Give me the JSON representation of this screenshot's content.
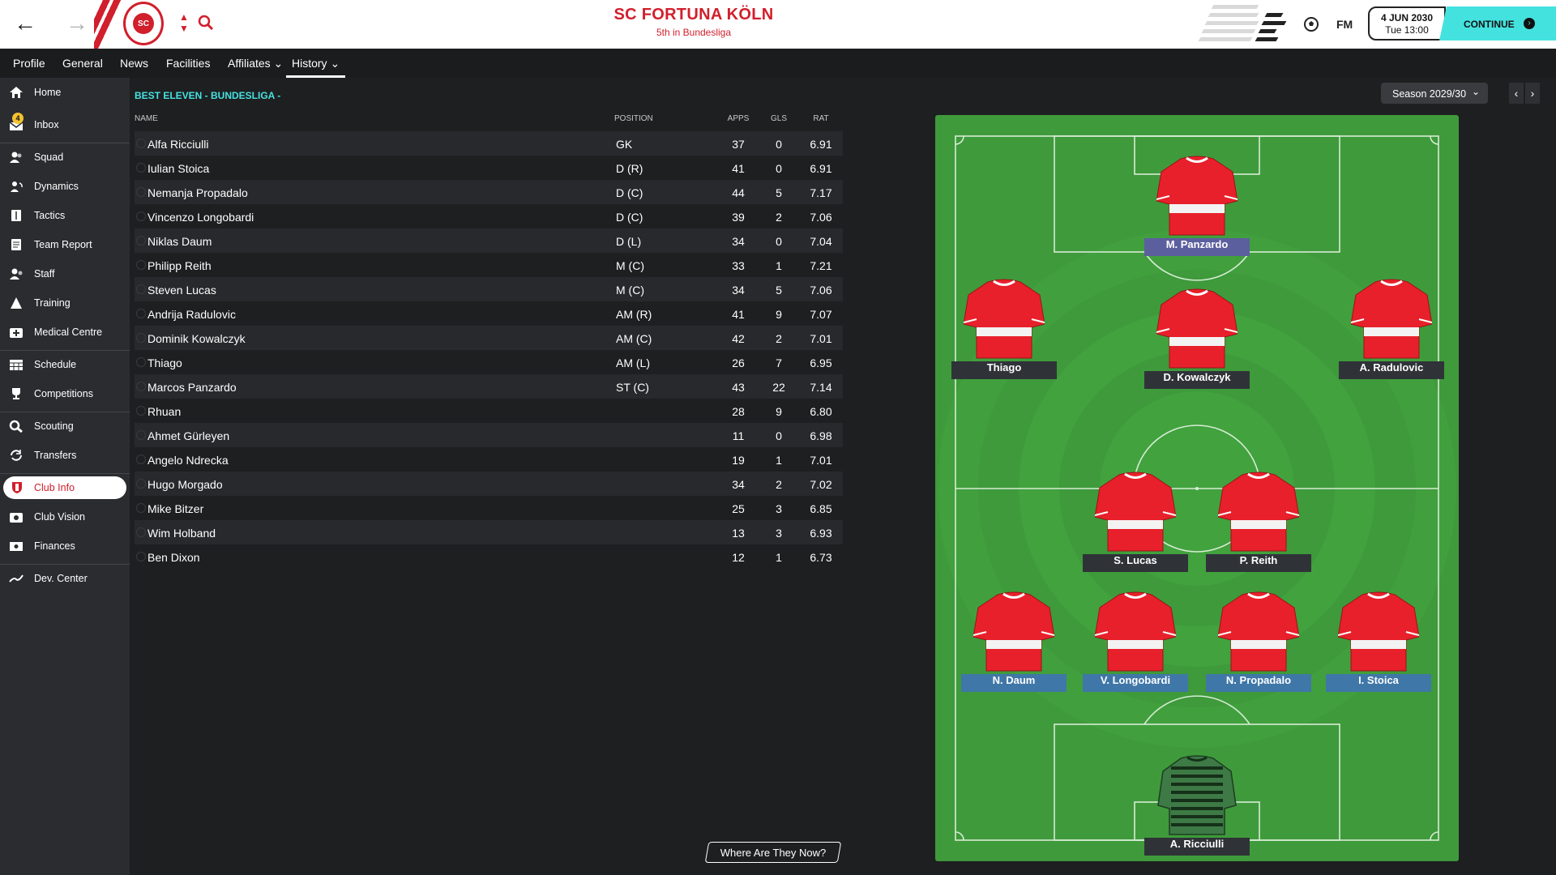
{
  "header": {
    "club_name": "SC FORTUNA KÖLN",
    "club_sub": "5th in Bundesliga",
    "crest_text": "SC FORTUNA KÖLN",
    "fm_logo": "FM",
    "date": "4 JUN 2030",
    "time": "Tue 13:00",
    "continue_label": "CONTINUE",
    "back_icon": "←",
    "forward_icon": "→",
    "continue_icon": "›"
  },
  "tabs": [
    {
      "label": "Profile"
    },
    {
      "label": "General"
    },
    {
      "label": "News"
    },
    {
      "label": "Facilities"
    },
    {
      "label": "Affiliates ⌄"
    },
    {
      "label": "History ⌄"
    }
  ],
  "sidebar": {
    "inbox_badge": "4",
    "items": [
      {
        "label": "Home",
        "icon": "home-icon"
      },
      {
        "label": "Inbox",
        "icon": "inbox-icon"
      },
      {
        "label": "Squad",
        "icon": "squad-icon"
      },
      {
        "label": "Dynamics",
        "icon": "dynamics-icon"
      },
      {
        "label": "Tactics",
        "icon": "tactics-icon"
      },
      {
        "label": "Team Report",
        "icon": "team-report-icon"
      },
      {
        "label": "Staff",
        "icon": "staff-icon"
      },
      {
        "label": "Training",
        "icon": "training-icon"
      },
      {
        "label": "Medical Centre",
        "icon": "medical-icon"
      },
      {
        "label": "Schedule",
        "icon": "schedule-icon"
      },
      {
        "label": "Competitions",
        "icon": "trophy-icon"
      },
      {
        "label": "Scouting",
        "icon": "scouting-icon"
      },
      {
        "label": "Transfers",
        "icon": "transfers-icon"
      },
      {
        "label": "Club Info",
        "icon": "shield-icon"
      },
      {
        "label": "Club Vision",
        "icon": "club-vision-icon"
      },
      {
        "label": "Finances",
        "icon": "finances-icon"
      },
      {
        "label": "Dev. Center",
        "icon": "dev-center-icon"
      }
    ]
  },
  "table": {
    "title": "BEST ELEVEN - BUNDESLIGA -",
    "headers": {
      "name": "NAME",
      "position": "POSITION",
      "apps": "APPS",
      "gls": "GLS",
      "rat": "RAT"
    },
    "rows": [
      {
        "name": "Alfa Ricciulli",
        "position": "GK",
        "apps": "37",
        "gls": "0",
        "rat": "6.91"
      },
      {
        "name": "Iulian Stoica",
        "position": "D (R)",
        "apps": "41",
        "gls": "0",
        "rat": "6.91"
      },
      {
        "name": "Nemanja Propadalo",
        "position": "D (C)",
        "apps": "44",
        "gls": "5",
        "rat": "7.17"
      },
      {
        "name": "Vincenzo Longobardi",
        "position": "D (C)",
        "apps": "39",
        "gls": "2",
        "rat": "7.06"
      },
      {
        "name": "Niklas Daum",
        "position": "D (L)",
        "apps": "34",
        "gls": "0",
        "rat": "7.04"
      },
      {
        "name": "Philipp Reith",
        "position": "M (C)",
        "apps": "33",
        "gls": "1",
        "rat": "7.21"
      },
      {
        "name": "Steven Lucas",
        "position": "M (C)",
        "apps": "34",
        "gls": "5",
        "rat": "7.06"
      },
      {
        "name": "Andrija Radulovic",
        "position": "AM (R)",
        "apps": "41",
        "gls": "9",
        "rat": "7.07"
      },
      {
        "name": "Dominik Kowalczyk",
        "position": "AM (C)",
        "apps": "42",
        "gls": "2",
        "rat": "7.01"
      },
      {
        "name": "Thiago",
        "position": "AM (L)",
        "apps": "26",
        "gls": "7",
        "rat": "6.95"
      },
      {
        "name": "Marcos Panzardo",
        "position": "ST (C)",
        "apps": "43",
        "gls": "22",
        "rat": "7.14"
      },
      {
        "name": "Rhuan",
        "position": "",
        "apps": "28",
        "gls": "9",
        "rat": "6.80"
      },
      {
        "name": "Ahmet Gürleyen",
        "position": "",
        "apps": "11",
        "gls": "0",
        "rat": "6.98"
      },
      {
        "name": "Angelo Ndrecka",
        "position": "",
        "apps": "19",
        "gls": "1",
        "rat": "7.01"
      },
      {
        "name": "Hugo Morgado",
        "position": "",
        "apps": "34",
        "gls": "2",
        "rat": "7.02"
      },
      {
        "name": "Mike Bitzer",
        "position": "",
        "apps": "25",
        "gls": "3",
        "rat": "6.85"
      },
      {
        "name": "Wim Holband",
        "position": "",
        "apps": "13",
        "gls": "3",
        "rat": "6.93"
      },
      {
        "name": "Ben Dixon",
        "position": "",
        "apps": "12",
        "gls": "1",
        "rat": "6.73"
      }
    ]
  },
  "where_button": "Where Are They Now?",
  "season_selector": {
    "value": "Season 2029/30"
  },
  "pitch": {
    "players": [
      {
        "label": "M. Panzardo",
        "role": "ST",
        "kit": "outfield"
      },
      {
        "label": "Thiago",
        "role": "AML",
        "kit": "outfield"
      },
      {
        "label": "D. Kowalczyk",
        "role": "AMC",
        "kit": "outfield"
      },
      {
        "label": "A. Radulovic",
        "role": "AMR",
        "kit": "outfield"
      },
      {
        "label": "S. Lucas",
        "role": "MC",
        "kit": "outfield"
      },
      {
        "label": "P. Reith",
        "role": "MC",
        "kit": "outfield"
      },
      {
        "label": "N. Daum",
        "role": "DL",
        "kit": "outfield"
      },
      {
        "label": "V. Longobardi",
        "role": "DC",
        "kit": "outfield"
      },
      {
        "label": "N. Propadalo",
        "role": "DC",
        "kit": "outfield"
      },
      {
        "label": "I. Stoica",
        "role": "DR",
        "kit": "outfield"
      },
      {
        "label": "A. Ricciulli",
        "role": "GK",
        "kit": "goalkeeper"
      }
    ]
  },
  "colors": {
    "brand_red": "#d11f2c",
    "accent_cyan": "#44e2df",
    "pitch_green": "#3f9c3b",
    "label_attack": "#5c5f9e",
    "label_defence": "#3f77a8",
    "label_midfield": "#2f3338"
  }
}
